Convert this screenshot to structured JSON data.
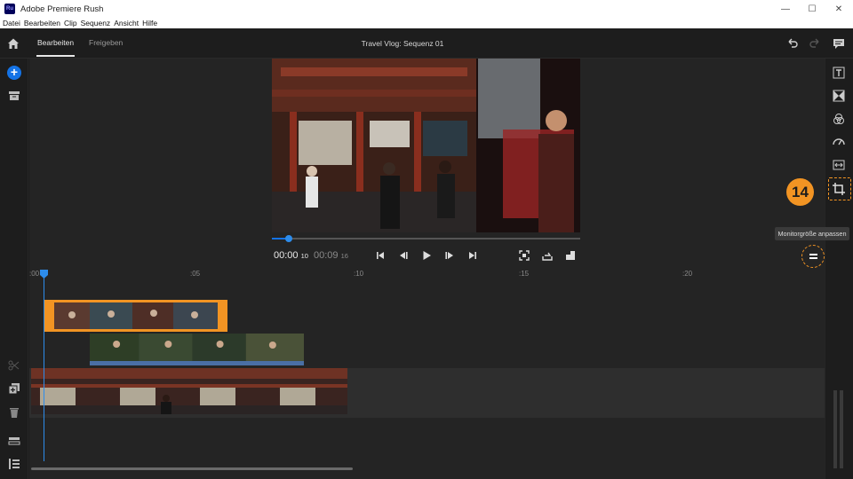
{
  "window": {
    "title": "Adobe Premiere Rush",
    "app_icon_text": "Ru",
    "controls": {
      "minimize": "—",
      "maximize": "☐",
      "close": "✕"
    }
  },
  "menu": [
    "Datei",
    "Bearbeiten",
    "Clip",
    "Sequenz",
    "Ansicht",
    "Hilfe"
  ],
  "header": {
    "tabs": [
      {
        "label": "Bearbeiten",
        "active": true
      },
      {
        "label": "Freigeben",
        "active": false
      }
    ],
    "sequence_title": "Travel Vlog: Sequenz 01"
  },
  "player": {
    "current_time": "00:00",
    "current_frames": "10",
    "duration_time": "00:09",
    "duration_frames": "16",
    "playhead_progress": 0.05
  },
  "timeline": {
    "ruler_labels": [
      ":00",
      ":05",
      ":10",
      ":15",
      ":20"
    ]
  },
  "tutorial": {
    "step_number": "14",
    "tooltip": "Monitorgröße anpassen"
  },
  "colors": {
    "accent_blue": "#1473e6",
    "highlight_orange": "#f29423",
    "background": "#1d1d1d"
  }
}
